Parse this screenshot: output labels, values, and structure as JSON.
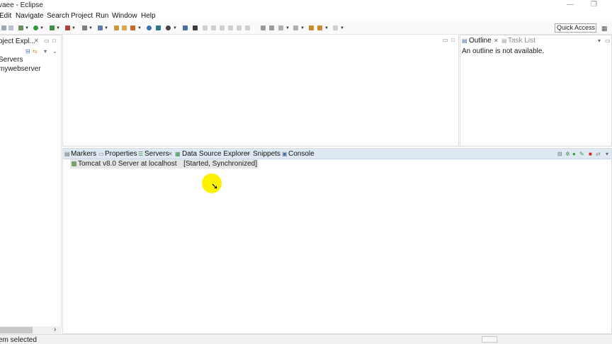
{
  "window": {
    "title": "vaee - Eclipse",
    "minimize_glyph": "—",
    "restore_glyph": "❐"
  },
  "menubar": {
    "items": [
      "Edit",
      "Navigate",
      "Search",
      "Project",
      "Run",
      "Window",
      "Help"
    ]
  },
  "toolbar": {
    "quick_access": "Quick Access"
  },
  "project_explorer": {
    "tab_label": "oject Expl...",
    "items": [
      "Servers",
      "mywebserver"
    ]
  },
  "outline_pane": {
    "tabs": [
      {
        "label": "Outline",
        "active": true
      },
      {
        "label": "Task List",
        "active": false
      }
    ],
    "message": "An outline is not available."
  },
  "servers_pane": {
    "tabs": [
      "Markers",
      "Properties",
      "Servers",
      "Data Source Explorer",
      "Snippets",
      "Console"
    ],
    "active_tab": "Servers",
    "server": {
      "name": "Tomcat v8.0 Server at localhost",
      "status": "[Started, Synchronized]"
    }
  },
  "statusbar": {
    "text": "em selected"
  },
  "colors": {
    "highlight": "#fff200",
    "tabbar": "#dfe9f3",
    "server_row": "#e6e6e6"
  }
}
